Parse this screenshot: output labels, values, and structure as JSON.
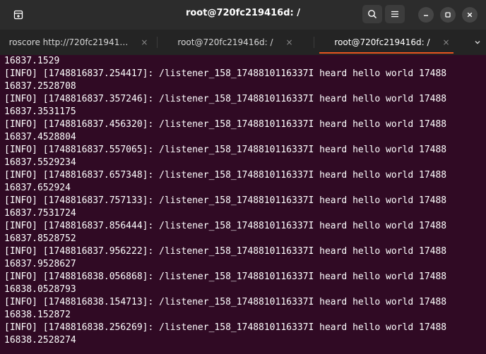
{
  "window": {
    "title": "root@720fc219416d: /"
  },
  "titlebar_icons": [
    "new-tab-icon",
    "search-icon",
    "hamburger-menu-icon",
    "minimize-icon",
    "maximize-icon",
    "close-icon"
  ],
  "tabs": [
    {
      "label": "roscore http://720fc21941…",
      "close": "×",
      "active": false
    },
    {
      "label": "root@720fc219416d: /",
      "close": "×",
      "active": false
    },
    {
      "label": "root@720fc219416d: /",
      "close": "×",
      "active": true
    }
  ],
  "tab_dropdown_icon": "chevron-down-icon",
  "colors": {
    "terminal_bg": "#300a24",
    "terminal_fg": "#ffffff",
    "active_tab_accent": "#e95420",
    "titlebar_bg": "#2c2c2c",
    "tabbar_bg": "#242424"
  },
  "terminal": {
    "lines": [
      "16837.1529",
      "[INFO] [1748816837.254417]: /listener_158_1748810116337I heard hello world 17488",
      "16837.2528708",
      "[INFO] [1748816837.357246]: /listener_158_1748810116337I heard hello world 17488",
      "16837.3531175",
      "[INFO] [1748816837.456320]: /listener_158_1748810116337I heard hello world 17488",
      "16837.4528804",
      "[INFO] [1748816837.557065]: /listener_158_1748810116337I heard hello world 17488",
      "16837.5529234",
      "[INFO] [1748816837.657348]: /listener_158_1748810116337I heard hello world 17488",
      "16837.652924",
      "[INFO] [1748816837.757133]: /listener_158_1748810116337I heard hello world 17488",
      "16837.7531724",
      "[INFO] [1748816837.856444]: /listener_158_1748810116337I heard hello world 17488",
      "16837.8528752",
      "[INFO] [1748816837.956222]: /listener_158_1748810116337I heard hello world 17488",
      "16837.9528627",
      "[INFO] [1748816838.056868]: /listener_158_1748810116337I heard hello world 17488",
      "16838.0528793",
      "[INFO] [1748816838.154713]: /listener_158_1748810116337I heard hello world 17488",
      "16838.152872",
      "[INFO] [1748816838.256269]: /listener_158_1748810116337I heard hello world 17488",
      "16838.2528274"
    ]
  }
}
